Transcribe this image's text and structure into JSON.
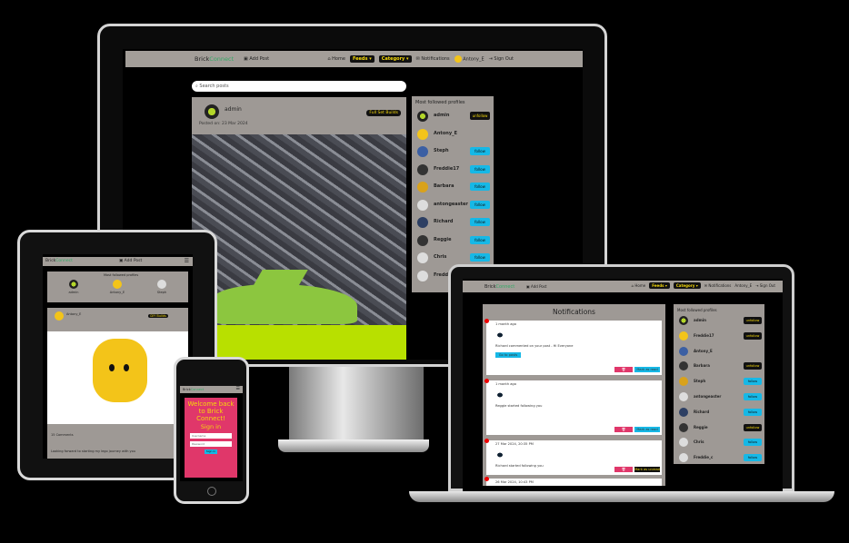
{
  "brand": {
    "part1": "Brick",
    "part2": "Connect"
  },
  "desktop": {
    "nav": {
      "add_post": "▣ Add Post",
      "home": "⌂ Home",
      "feeds": "Feeds ▾",
      "category": "Category ▾",
      "notifications": "✉ Notifications",
      "user": "Antony_E",
      "sign_out": "⇥ Sign Out"
    },
    "search_placeholder": "Search posts",
    "post": {
      "author": "admin",
      "date": "Posted on: 23 Mar 2024",
      "tag": "Full Set Builds"
    },
    "most_followed": {
      "title": "Most followed profiles",
      "profiles": [
        {
          "name": "admin",
          "action": "unfollow"
        },
        {
          "name": "Antony_E",
          "action": ""
        },
        {
          "name": "Steph",
          "action": "follow"
        },
        {
          "name": "Freddie17",
          "action": "follow"
        },
        {
          "name": "Barbara",
          "action": "follow"
        },
        {
          "name": "antongeaster",
          "action": "follow"
        },
        {
          "name": "Richard",
          "action": "follow"
        },
        {
          "name": "Reggie",
          "action": "follow"
        },
        {
          "name": "Chris",
          "action": "follow"
        },
        {
          "name": "Freddie_c",
          "action": "follow"
        }
      ]
    }
  },
  "tablet": {
    "add_post": "▣ Add Post",
    "most_followed_title": "Most followed profiles",
    "profiles": [
      "admin",
      "Antony_E",
      "Steph"
    ],
    "post": {
      "author": "Antony_E",
      "tag": "DIY Builds",
      "comments": "15 Comments",
      "body": "Looking forward to starting my lego journey with you"
    }
  },
  "phone": {
    "heading": "Welcome back to Brick Connect!",
    "sign_in": "Sign in",
    "username_placeholder": "Username",
    "password_placeholder": "Password",
    "submit": "Sign in"
  },
  "laptop": {
    "title": "Notifications",
    "notifications": [
      {
        "time": "1 month ago",
        "message": "Richard commented on your post - Hi Everyone",
        "goto": "Go to posts",
        "delete": "🗑",
        "mark": "Mark as read"
      },
      {
        "time": "1 month ago",
        "message": "Reggie started following you",
        "goto": "",
        "delete": "🗑",
        "mark": "Mark as read"
      },
      {
        "time": "27 Mar 2024, 20:35 PM",
        "message": "Richard started following you",
        "goto": "",
        "delete": "🗑",
        "mark": "Mark as unread"
      },
      {
        "time": "26 Mar 2024, 10:43 PM",
        "message": "",
        "goto": "",
        "delete": "",
        "mark": ""
      }
    ],
    "most_followed": {
      "title": "Most followed profiles",
      "profiles": [
        {
          "name": "admin",
          "action": "unfollow"
        },
        {
          "name": "Freddie17",
          "action": "unfollow"
        },
        {
          "name": "Antony_E",
          "action": ""
        },
        {
          "name": "Barbara",
          "action": "unfollow"
        },
        {
          "name": "Steph",
          "action": "follow"
        },
        {
          "name": "antongeaster",
          "action": "follow"
        },
        {
          "name": "Richard",
          "action": "follow"
        },
        {
          "name": "Reggie",
          "action": "unfollow"
        },
        {
          "name": "Chris",
          "action": "follow"
        },
        {
          "name": "Freddie_c",
          "action": "follow"
        }
      ]
    }
  },
  "labels": {
    "follow": "follow",
    "unfollow": "unfollow"
  },
  "colors": {
    "accent_yellow": "#f5d90a",
    "follow_blue": "#16b8e6",
    "login_pink": "#e0376a",
    "panel_grey": "#9e9995"
  }
}
